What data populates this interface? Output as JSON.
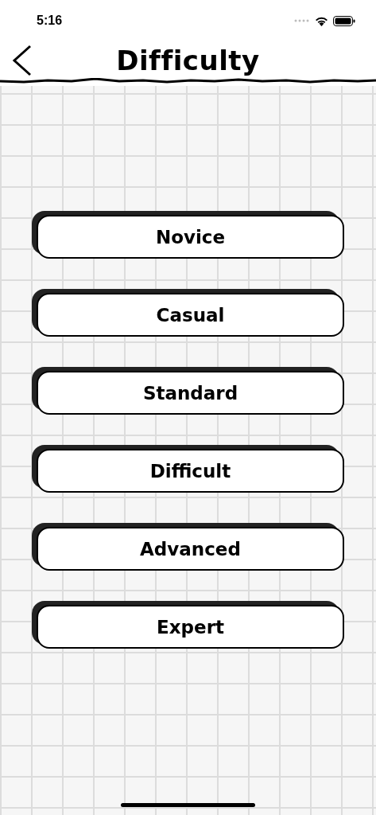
{
  "status_bar": {
    "time": "5:16"
  },
  "header": {
    "title": "Difficulty"
  },
  "levels": [
    {
      "label": "Novice"
    },
    {
      "label": "Casual"
    },
    {
      "label": "Standard"
    },
    {
      "label": "Difficult"
    },
    {
      "label": "Advanced"
    },
    {
      "label": "Expert"
    }
  ]
}
